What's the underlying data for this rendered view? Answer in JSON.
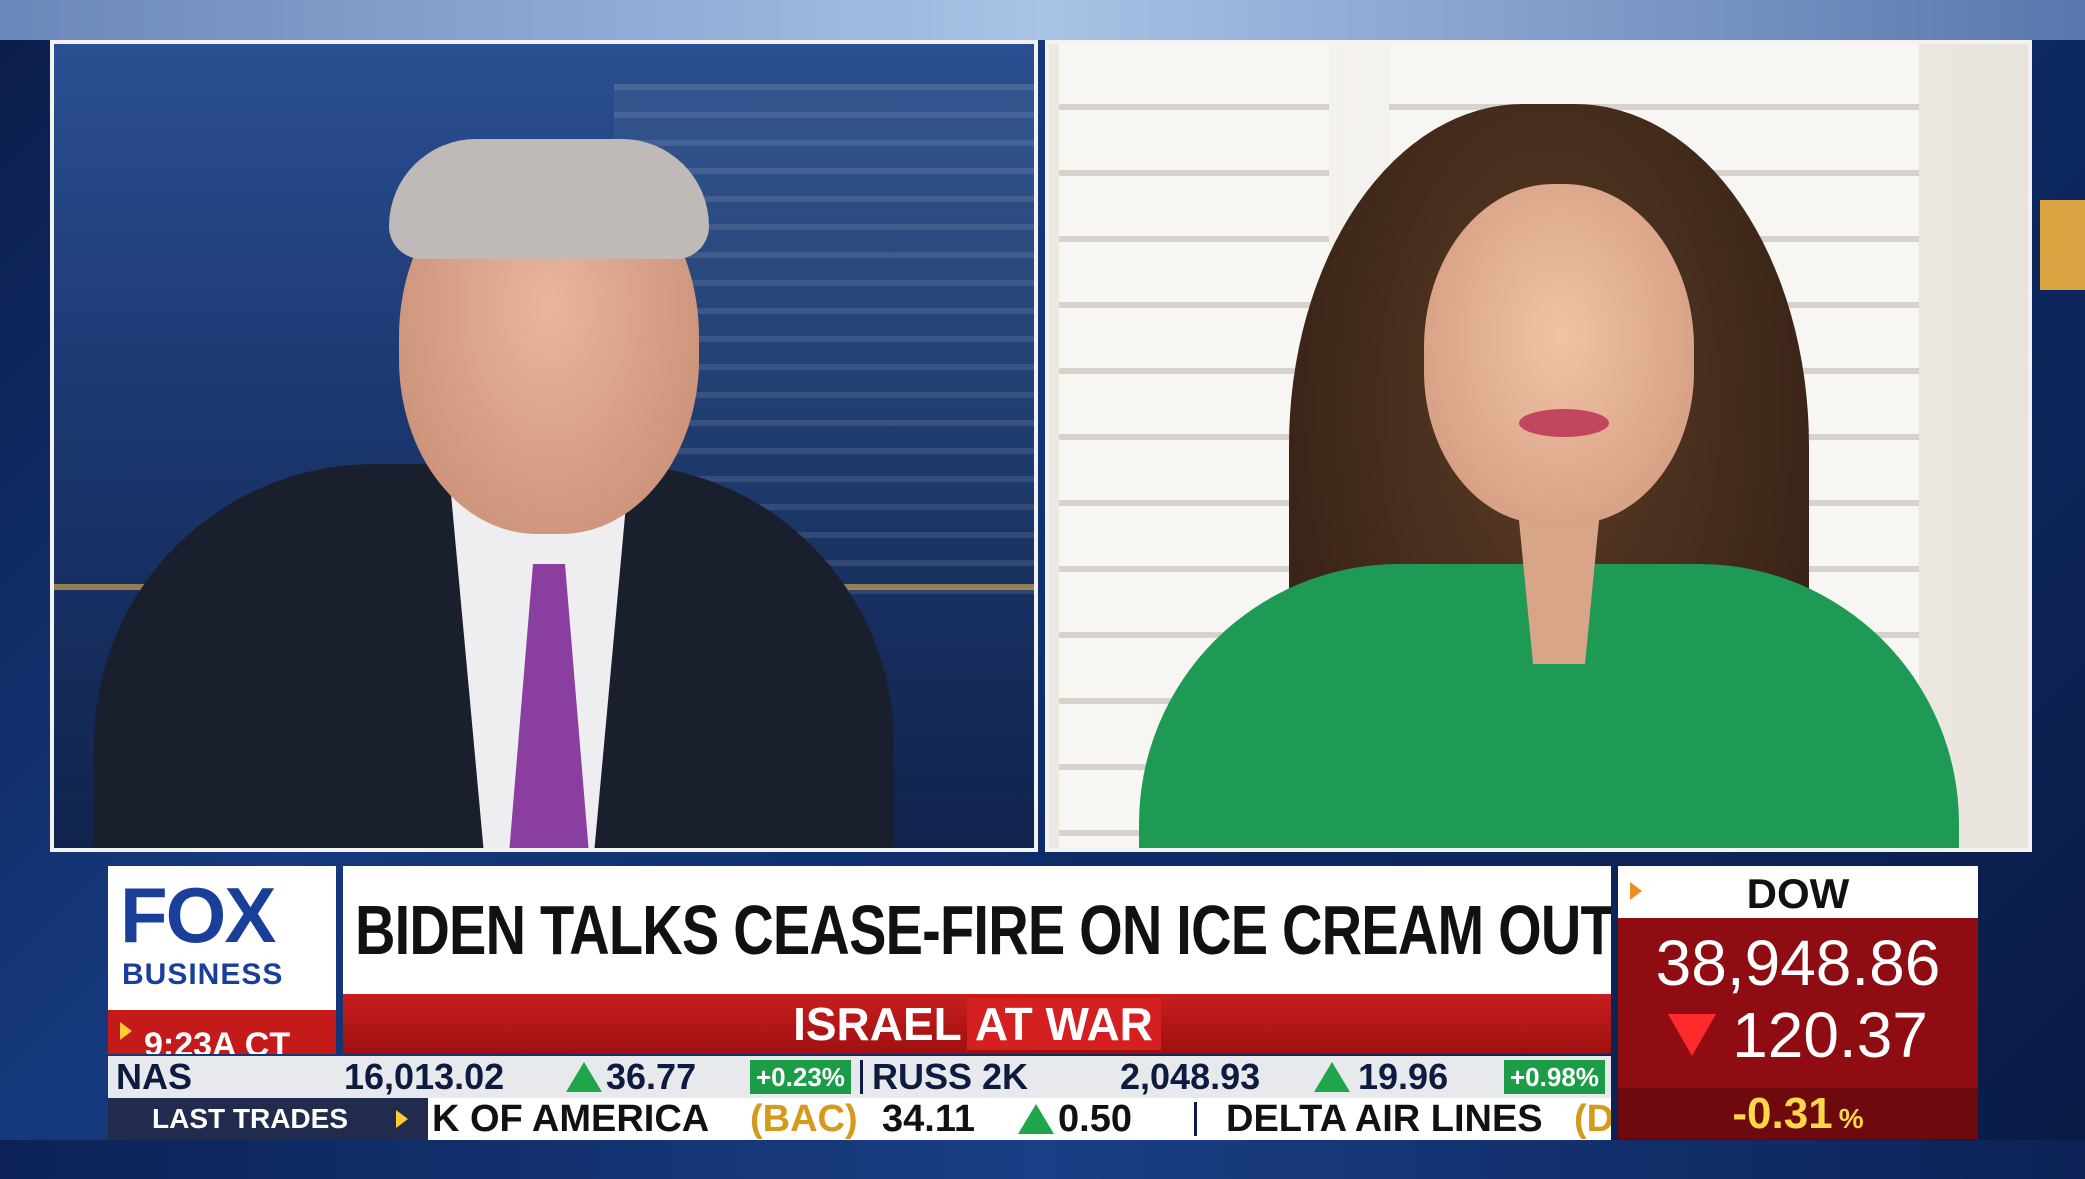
{
  "network": {
    "logo_top": "FOX",
    "logo_bottom": "BUSINESS",
    "time": "9:23A CT"
  },
  "headline": {
    "main": "BIDEN TALKS CEASE-FIRE ON ICE CREAM OUTING IN NYC",
    "sub_primary": "ISRAEL",
    "sub_accent": "AT WAR"
  },
  "dow": {
    "label": "DOW",
    "value": "38,948.86",
    "change": "120.37",
    "change_direction": "down",
    "percent": "-0.31",
    "percent_sign": "%"
  },
  "ticker_indices": [
    {
      "name": "NAS",
      "value": "16,013.02",
      "change": "36.77",
      "direction": "up",
      "percent": "+0.23%"
    },
    {
      "name": "RUSS 2K",
      "value": "2,048.93",
      "change": "19.96",
      "direction": "up",
      "percent": "+0.98%"
    }
  ],
  "last_trades": {
    "label": "LAST TRADES",
    "items": [
      {
        "name": "K OF AMERICA",
        "symbol": "(BAC)",
        "price": "34.11",
        "change": "0.50",
        "direction": "up"
      },
      {
        "name": "DELTA AIR LINES",
        "symbol": "(D"
      }
    ]
  },
  "colors": {
    "fox_blue": "#1a3f9a",
    "alert_red": "#c41a1a",
    "up_green": "#1fa64a",
    "down_red": "#ff2a2a",
    "percent_yellow": "#ffd84a"
  }
}
